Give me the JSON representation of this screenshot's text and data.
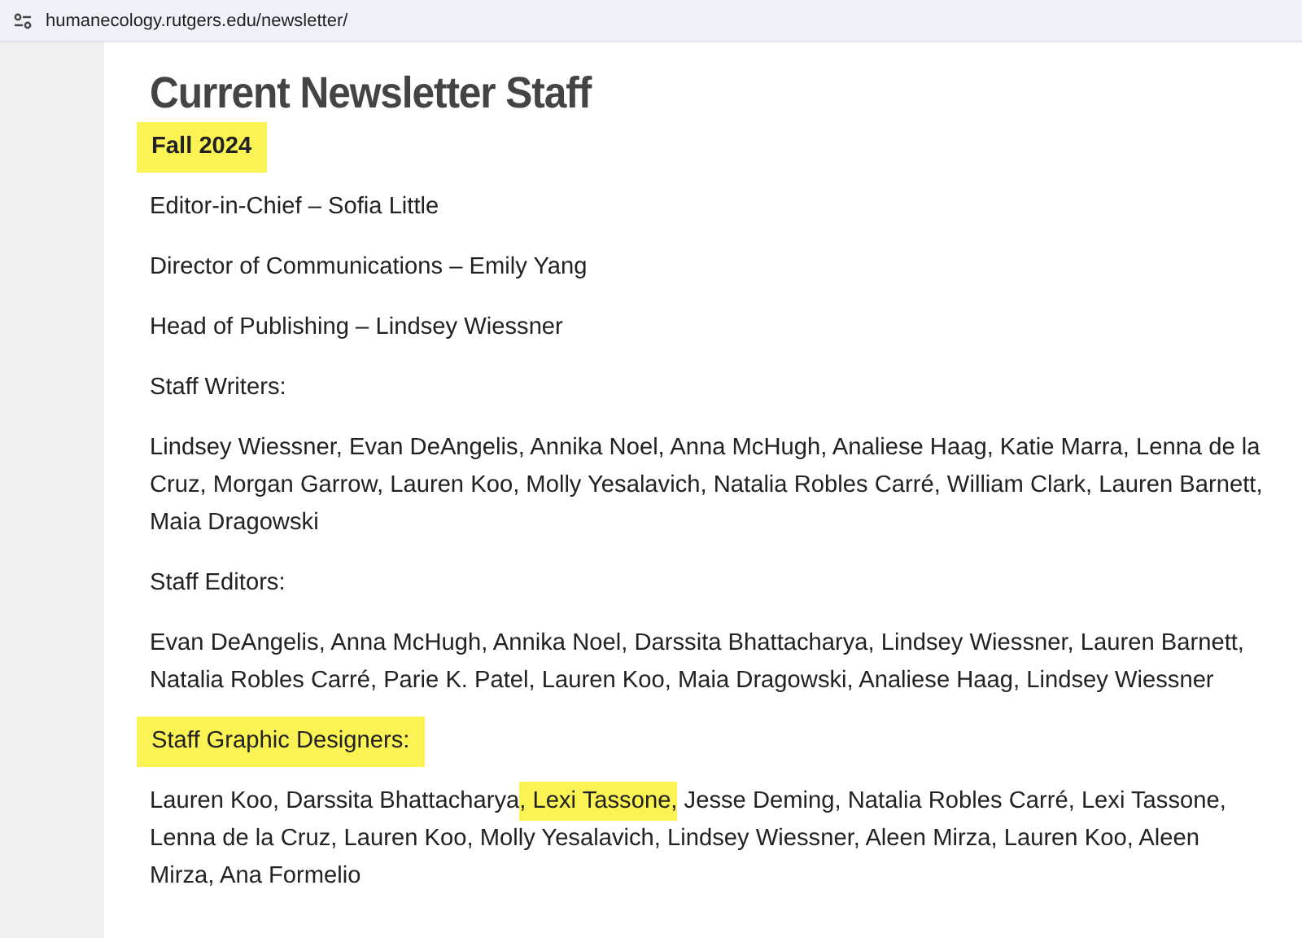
{
  "address_bar": {
    "url": "humanecology.rutgers.edu/newsletter/"
  },
  "title": "Current Newsletter Staff",
  "blocks": [
    {
      "kind": "heading",
      "highlighted": true,
      "segments": [
        {
          "text": "Fall 2024",
          "highlighted": false
        }
      ]
    },
    {
      "kind": "paragraph",
      "highlighted": false,
      "segments": [
        {
          "text": "Editor-in-Chief – Sofia Little",
          "highlighted": false
        }
      ]
    },
    {
      "kind": "paragraph",
      "highlighted": false,
      "segments": [
        {
          "text": "Director of Communications – Emily Yang",
          "highlighted": false
        }
      ]
    },
    {
      "kind": "paragraph",
      "highlighted": false,
      "segments": [
        {
          "text": "Head of Publishing – Lindsey Wiessner",
          "highlighted": false
        }
      ]
    },
    {
      "kind": "paragraph",
      "highlighted": false,
      "segments": [
        {
          "text": "Staff Writers:",
          "highlighted": false
        }
      ]
    },
    {
      "kind": "paragraph",
      "highlighted": false,
      "segments": [
        {
          "text": "Lindsey Wiessner, Evan DeAngelis, Annika Noel, Anna McHugh, Analiese Haag, Katie Marra, Lenna de la Cruz, Morgan Garrow, Lauren Koo, Molly Yesalavich, Natalia Robles Carré, William Clark, Lauren Barnett, Maia Dragowski",
          "highlighted": false
        }
      ]
    },
    {
      "kind": "paragraph",
      "highlighted": false,
      "segments": [
        {
          "text": "Staff Editors:",
          "highlighted": false
        }
      ]
    },
    {
      "kind": "paragraph",
      "highlighted": false,
      "segments": [
        {
          "text": "Evan DeAngelis, Anna McHugh, Annika Noel, Darssita Bhattacharya, Lindsey Wiessner, Lauren Barnett, Natalia Robles Carré, Parie K. Patel, Lauren Koo, Maia Dragowski, Analiese Haag, Lindsey Wiessner",
          "highlighted": false
        }
      ]
    },
    {
      "kind": "paragraph",
      "highlighted": true,
      "segments": [
        {
          "text": "Staff Graphic Designers:",
          "highlighted": false
        }
      ]
    },
    {
      "kind": "paragraph",
      "highlighted": false,
      "segments": [
        {
          "text": "Lauren Koo, Darssita Bhattacharya",
          "highlighted": false
        },
        {
          "text": ", Lexi Tassone,",
          "highlighted": true
        },
        {
          "text": " Jesse Deming, Natalia Robles Carré, Lexi Tassone, Lenna de la Cruz, Lauren Koo, Molly Yesalavich, Lindsey Wiessner, Aleen Mirza, Lauren Koo, Aleen Mirza, Ana Formelio",
          "highlighted": false
        }
      ]
    }
  ]
}
